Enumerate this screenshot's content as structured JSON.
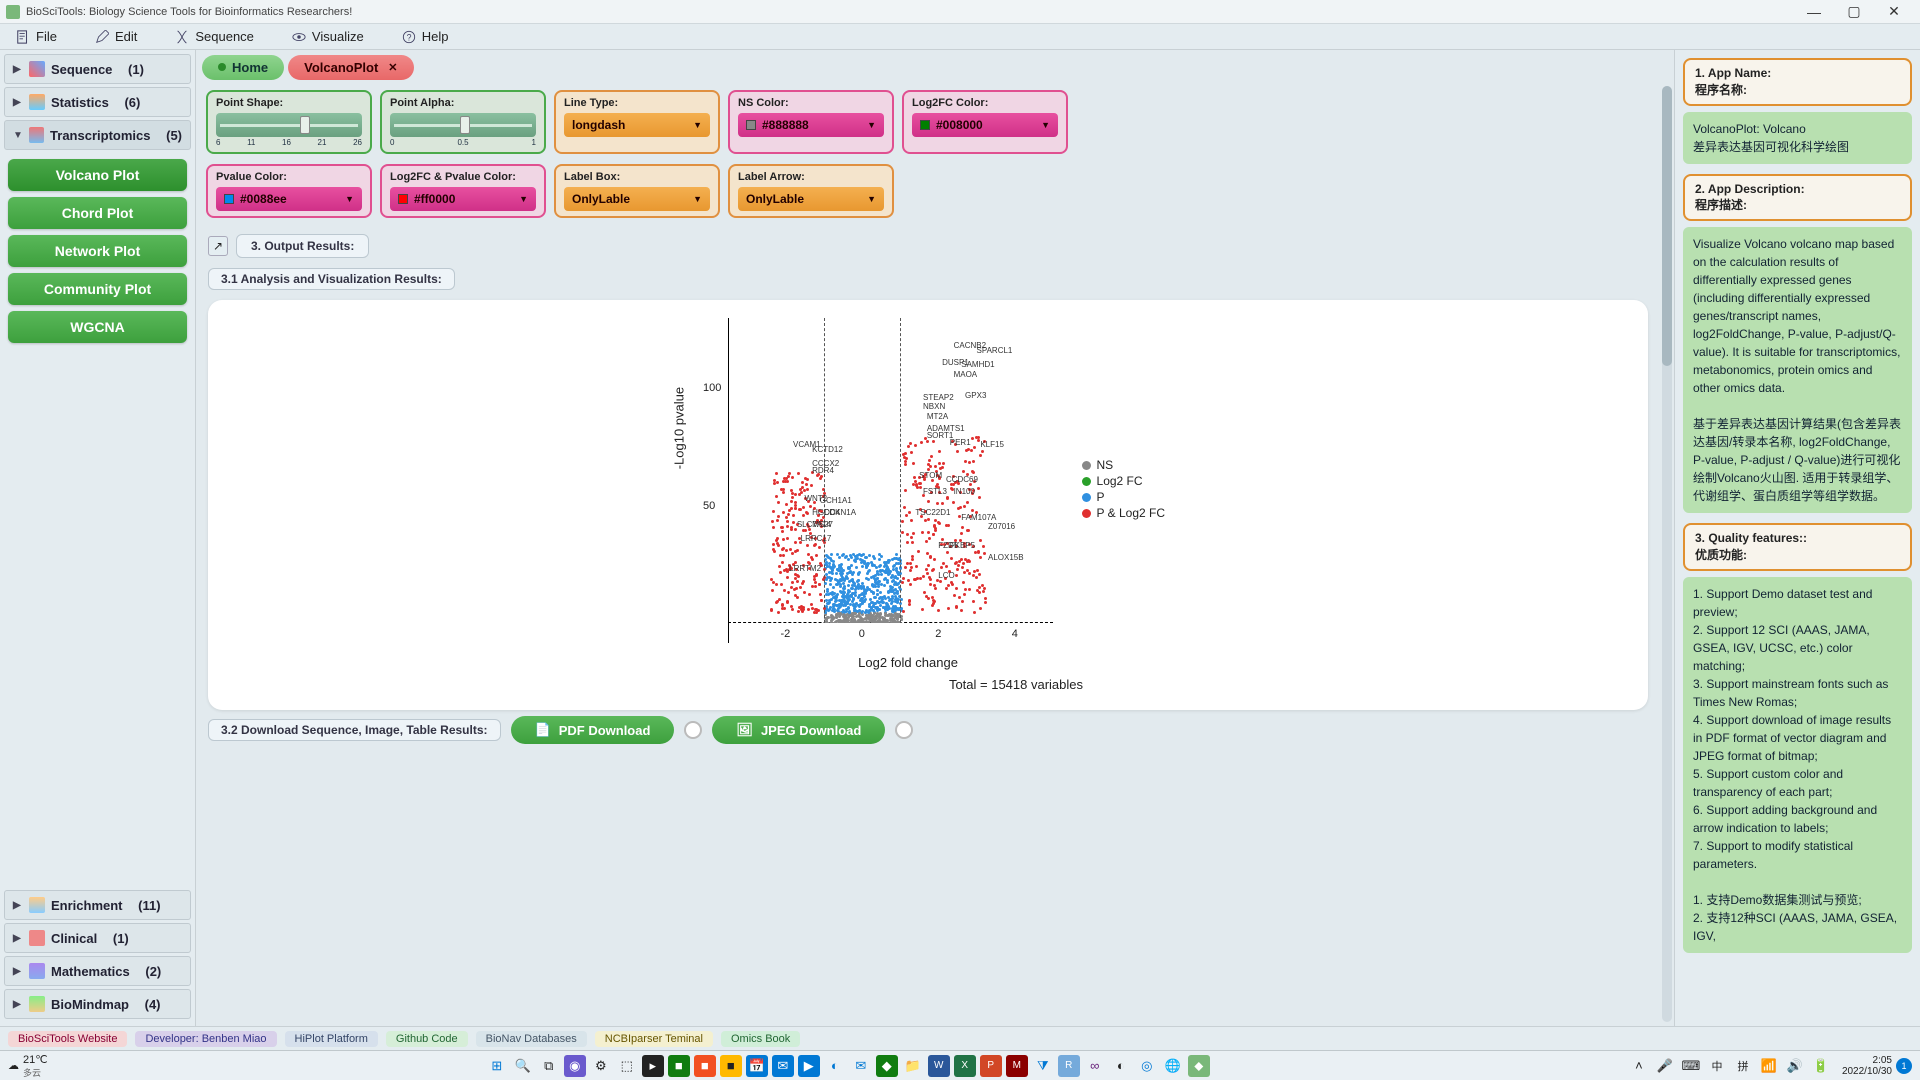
{
  "window": {
    "title": "BioSciTools: Biology Science Tools for Bioinformatics Researchers!"
  },
  "menubar": {
    "file": "File",
    "edit": "Edit",
    "sequence": "Sequence",
    "visualize": "Visualize",
    "help": "Help"
  },
  "sidebar": {
    "groups": {
      "sequence": {
        "label": "Sequence",
        "count": "(1)"
      },
      "statistics": {
        "label": "Statistics",
        "count": "(6)"
      },
      "transcriptomics": {
        "label": "Transcriptomics",
        "count": "(5)"
      },
      "enrichment": {
        "label": "Enrichment",
        "count": "(11)"
      },
      "clinical": {
        "label": "Clinical",
        "count": "(1)"
      },
      "mathematics": {
        "label": "Mathematics",
        "count": "(2)"
      },
      "biomindmap": {
        "label": "BioMindmap",
        "count": "(4)"
      }
    },
    "buttons": {
      "volcano": "Volcano Plot",
      "chord": "Chord Plot",
      "network": "Network Plot",
      "community": "Community Plot",
      "wgcna": "WGCNA"
    }
  },
  "tabs": {
    "home": "Home",
    "volcano": "VolcanoPlot"
  },
  "params": {
    "point_shape": {
      "label": "Point Shape:",
      "ticks": [
        "6",
        "11",
        "16",
        "21",
        "26"
      ]
    },
    "point_alpha": {
      "label": "Point Alpha:",
      "ticks": [
        "0",
        "0.5",
        "1"
      ]
    },
    "line_type": {
      "label": "Line Type:",
      "value": "longdash"
    },
    "ns_color": {
      "label": "NS Color:",
      "value": "#888888"
    },
    "log2fc_color": {
      "label": "Log2FC Color:",
      "value": "#008000"
    },
    "pvalue_color": {
      "label": "Pvalue Color:",
      "value": "#0088ee"
    },
    "both_color": {
      "label": "Log2FC & Pvalue Color:",
      "value": "#ff0000"
    },
    "label_box": {
      "label": "Label Box:",
      "value": "OnlyLable"
    },
    "label_arrow": {
      "label": "Label Arrow:",
      "value": "OnlyLable"
    }
  },
  "sections": {
    "output": "3. Output Results:",
    "analysis": "3.1 Analysis and Visualization Results:",
    "download": "3.2 Download Sequence, Image, Table Results:"
  },
  "download": {
    "pdf": "PDF Download",
    "jpeg": "JPEG Download"
  },
  "chart_data": {
    "type": "scatter",
    "title": "",
    "xlabel": "Log2 fold change",
    "ylabel": "-Log10 pvalue",
    "total_label": "Total = 15418 variables",
    "xlim": [
      -3.5,
      5
    ],
    "ylim": [
      0,
      130
    ],
    "xticks": [
      -2,
      0,
      2,
      4
    ],
    "yticks": [
      50,
      100
    ],
    "vlines": [
      -1,
      1
    ],
    "hline": 5,
    "legend": [
      {
        "name": "NS",
        "color": "#888888"
      },
      {
        "name": "Log2 FC",
        "color": "#2aa02a"
      },
      {
        "name": "P",
        "color": "#3090e0"
      },
      {
        "name": "P & Log2 FC",
        "color": "#e03030"
      }
    ],
    "gene_labels": [
      {
        "name": "CACNB2",
        "x": 2.4,
        "y": 120
      },
      {
        "name": "SPARCL1",
        "x": 3.0,
        "y": 118
      },
      {
        "name": "DUSP1",
        "x": 2.1,
        "y": 113
      },
      {
        "name": "SAMHD1",
        "x": 2.6,
        "y": 112
      },
      {
        "name": "MAOA",
        "x": 2.4,
        "y": 108
      },
      {
        "name": "GPX3",
        "x": 2.7,
        "y": 99
      },
      {
        "name": "STEAP2",
        "x": 1.6,
        "y": 98
      },
      {
        "name": "NBXN",
        "x": 1.6,
        "y": 94
      },
      {
        "name": "MT2A",
        "x": 1.7,
        "y": 90
      },
      {
        "name": "ADAMTS1",
        "x": 1.7,
        "y": 85
      },
      {
        "name": "SORT1",
        "x": 1.7,
        "y": 82
      },
      {
        "name": "PER1",
        "x": 2.3,
        "y": 79
      },
      {
        "name": "KLF15",
        "x": 3.1,
        "y": 78
      },
      {
        "name": "VCAM1",
        "x": -1.8,
        "y": 78
      },
      {
        "name": "KCTD12",
        "x": -1.3,
        "y": 76
      },
      {
        "name": "CCCX2",
        "x": -1.3,
        "y": 70
      },
      {
        "name": "RDR4",
        "x": -1.3,
        "y": 67
      },
      {
        "name": "STOM",
        "x": 1.5,
        "y": 65
      },
      {
        "name": "CCDC69",
        "x": 2.2,
        "y": 63
      },
      {
        "name": "IN100",
        "x": 2.4,
        "y": 58
      },
      {
        "name": "FSTL3",
        "x": 1.6,
        "y": 58
      },
      {
        "name": "WNT2",
        "x": -1.5,
        "y": 55
      },
      {
        "name": "GCH1A1",
        "x": -1.1,
        "y": 54
      },
      {
        "name": "HGDC4",
        "x": -1.3,
        "y": 49
      },
      {
        "name": "CDKN1A",
        "x": -1.0,
        "y": 49
      },
      {
        "name": "TSC22D1",
        "x": 1.4,
        "y": 49
      },
      {
        "name": "FAM107A",
        "x": 2.6,
        "y": 47
      },
      {
        "name": "SLC7A14",
        "x": -1.7,
        "y": 44
      },
      {
        "name": "MS27",
        "x": -1.3,
        "y": 44
      },
      {
        "name": "Z07016",
        "x": 3.3,
        "y": 43
      },
      {
        "name": "LRRC17",
        "x": -1.6,
        "y": 38
      },
      {
        "name": "FZD5",
        "x": 2.0,
        "y": 35
      },
      {
        "name": "FKBP5",
        "x": 2.3,
        "y": 35
      },
      {
        "name": "ALOX15B",
        "x": 3.3,
        "y": 30
      },
      {
        "name": "LRRTM2",
        "x": -1.9,
        "y": 25
      },
      {
        "name": "LCO",
        "x": 2.0,
        "y": 22
      }
    ]
  },
  "info": {
    "app_name_hdr": "1. App Name:\n程序名称:",
    "app_name_body": "VolcanoPlot: Volcano\n差异表达基因可视化科学绘图",
    "app_desc_hdr": "2. App Description:\n程序描述:",
    "app_desc_body": "Visualize Volcano volcano map based on the calculation results of differentially expressed genes (including differentially expressed genes/transcript names, log2FoldChange, P-value, P-adjust/Q-value). It is suitable for transcriptomics, metabonomics, protein omics and other omics data.\n\n基于差异表达基因计算结果(包含差异表达基因/转录本名称, log2FoldChange, P-value, P-adjust / Q-value)进行可视化绘制Volcano火山图. 适用于转录组学、代谢组学、蛋白质组学等组学数据。",
    "quality_hdr": "3. Quality features::\n优质功能:",
    "quality_body": "1. Support Demo dataset test and preview;\n2. Support 12 SCI (AAAS, JAMA, GSEA, IGV, UCSC, etc.) color matching;\n3. Support mainstream fonts such as Times New Romas;\n4. Support download of image results in PDF format of vector diagram and JPEG format of bitmap;\n5. Support custom color and transparency of each part;\n6. Support adding background and arrow indication to labels;\n7. Support to modify statistical parameters.\n\n1. 支持Demo数据集测试与预览;\n2. 支持12种SCI (AAAS, JAMA, GSEA, IGV,"
  },
  "footer": {
    "f1": "BioSciTools Website",
    "f2": "Developer: Benben Miao",
    "f3": "HiPlot Platform",
    "f4": "Github Code",
    "f5": "BioNav Databases",
    "f6": "NCBIparser Teminal",
    "f7": "Omics Book"
  },
  "taskbar": {
    "temp": "21℃",
    "weather": "多云",
    "time": "2:05",
    "date": "2022/10/30"
  }
}
